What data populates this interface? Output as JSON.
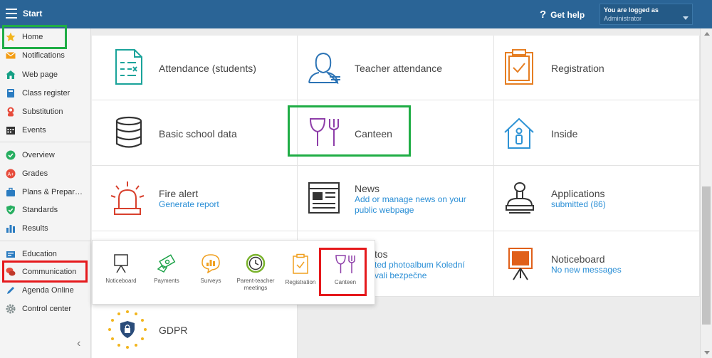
{
  "topbar": {
    "title": "Start",
    "help_label": "Get help",
    "user_line1": "You are logged as",
    "user_line2": "Administrator"
  },
  "sidebar": {
    "items": [
      {
        "label": "Home",
        "icon": "star-icon",
        "color": "#f2b51d"
      },
      {
        "label": "Notifications",
        "icon": "envelope-icon",
        "color": "#f39c12"
      },
      {
        "label": "Web page",
        "icon": "house-icon",
        "color": "#16a085"
      },
      {
        "label": "Class register",
        "icon": "book-icon",
        "color": "#2b7cc1"
      },
      {
        "label": "Substitution",
        "icon": "person-icon",
        "color": "#e74c3c"
      },
      {
        "label": "Events",
        "icon": "calendar-icon",
        "color": "#333333"
      },
      {
        "label": "Overview",
        "icon": "check-circle-icon",
        "color": "#27ae60"
      },
      {
        "label": "Grades",
        "icon": "grades-icon",
        "color": "#e74c3c"
      },
      {
        "label": "Plans & Prepar…",
        "icon": "briefcase-icon",
        "color": "#2b7cc1"
      },
      {
        "label": "Standards",
        "icon": "shield-check-icon",
        "color": "#27ae60"
      },
      {
        "label": "Results",
        "icon": "bar-chart-icon",
        "color": "#2b7cc1"
      },
      {
        "label": "Education",
        "icon": "education-icon",
        "color": "#2b7cc1"
      },
      {
        "label": "Communication",
        "icon": "chat-bubbles-icon",
        "color": "#e74c3c"
      },
      {
        "label": "Agenda Online",
        "icon": "pencil-icon",
        "color": "#2b7cc1"
      },
      {
        "label": "Control center",
        "icon": "gear-icon",
        "color": "#7f8c8d"
      }
    ]
  },
  "tiles": {
    "attendance": {
      "name": "Attendance (students)"
    },
    "teacher_attendance": {
      "name": "Teacher attendance"
    },
    "registration": {
      "name": "Registration"
    },
    "basic_data": {
      "name": "Basic school data"
    },
    "canteen": {
      "name": "Canteen"
    },
    "inside": {
      "name": "Inside"
    },
    "fire_alert": {
      "name": "Fire alert",
      "sub": "Generate report"
    },
    "news": {
      "name": "News",
      "sub1": "Add or manage news on your",
      "sub2": "public webpage"
    },
    "applications": {
      "name": "Applications",
      "sub": "submitted (86)"
    },
    "photos": {
      "name": "tos",
      "sub1": "ted photoalbum Kolední",
      "sub2": "vali bezpečne"
    },
    "noticeboard": {
      "name": "Noticeboard",
      "sub": "No new messages"
    },
    "gdpr": {
      "name": "GDPR"
    }
  },
  "popup": {
    "items": [
      {
        "label": "Noticeboard",
        "icon": "easel-icon"
      },
      {
        "label": "Payments",
        "icon": "payments-icon"
      },
      {
        "label": "Surveys",
        "icon": "surveys-icon"
      },
      {
        "label": "Parent-teacher meetings",
        "icon": "clock-icon"
      },
      {
        "label": "Registration",
        "icon": "clipboard-icon"
      },
      {
        "label": "Canteen",
        "icon": "fork-glass-icon"
      }
    ]
  },
  "colors": {
    "header": "#2a6496",
    "highlight_green": "#1fad45",
    "highlight_red": "#e5191c",
    "link": "#2b8fd6"
  }
}
